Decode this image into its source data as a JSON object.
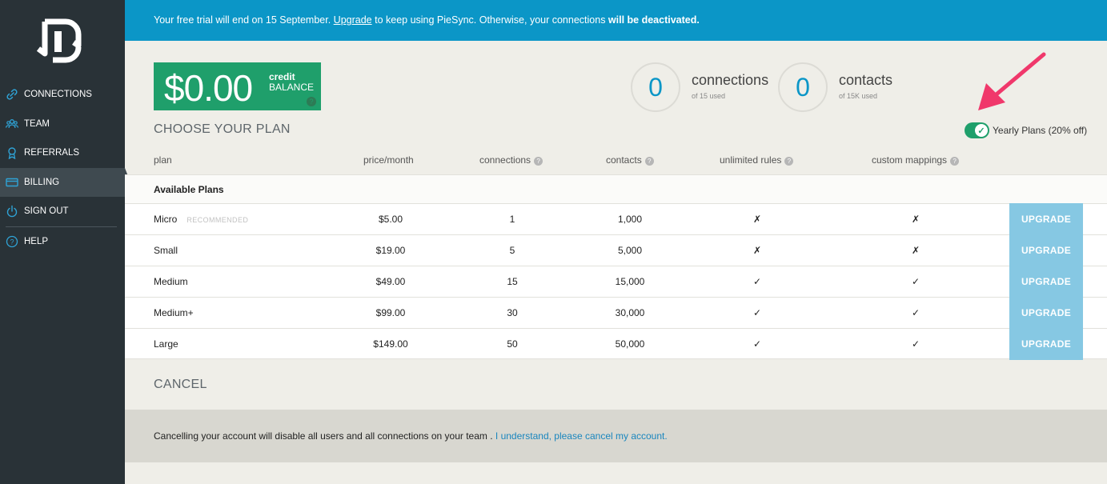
{
  "sidebar": {
    "items": [
      {
        "label": "CONNECTIONS",
        "icon": "link-icon"
      },
      {
        "label": "TEAM",
        "icon": "team-icon"
      },
      {
        "label": "REFERRALS",
        "icon": "award-icon"
      },
      {
        "label": "BILLING",
        "icon": "card-icon",
        "active": true
      },
      {
        "label": "SIGN OUT",
        "icon": "power-icon"
      },
      {
        "label": "HELP",
        "icon": "help-icon"
      }
    ]
  },
  "banner": {
    "before": "Your free trial will end on 15 September. ",
    "link": "Upgrade",
    "middle": " to keep using PieSync. Otherwise, your connections ",
    "bold": "will be deactivated."
  },
  "credit": {
    "amount": "$0.00",
    "label_top": "credit",
    "label_bottom": "BALANCE",
    "help": "?"
  },
  "stats": {
    "connections": {
      "count": "0",
      "label": "connections",
      "sub": "of 15 used"
    },
    "contacts": {
      "count": "0",
      "label": "contacts",
      "sub": "of 15K used"
    }
  },
  "plans": {
    "title": "CHOOSE YOUR PLAN",
    "yearly_toggle": {
      "label": "Yearly Plans (20% off)",
      "on": true,
      "check": "✓"
    },
    "headers": {
      "plan": "plan",
      "price": "price/month",
      "connections": "connections",
      "contacts": "contacts",
      "rules": "unlimited rules",
      "mappings": "custom mappings",
      "help": "?"
    },
    "group_label": "Available Plans",
    "rows": [
      {
        "name": "Micro",
        "badge": "RECOMMENDED",
        "price": "$5.00",
        "connections": "1",
        "contacts": "1,000",
        "rules": "✗",
        "mappings": "✗",
        "button": "UPGRADE"
      },
      {
        "name": "Small",
        "badge": "",
        "price": "$19.00",
        "connections": "5",
        "contacts": "5,000",
        "rules": "✗",
        "mappings": "✗",
        "button": "UPGRADE"
      },
      {
        "name": "Medium",
        "badge": "",
        "price": "$49.00",
        "connections": "15",
        "contacts": "15,000",
        "rules": "✓",
        "mappings": "✓",
        "button": "UPGRADE"
      },
      {
        "name": "Medium+",
        "badge": "",
        "price": "$99.00",
        "connections": "30",
        "contacts": "30,000",
        "rules": "✓",
        "mappings": "✓",
        "button": "UPGRADE"
      },
      {
        "name": "Large",
        "badge": "",
        "price": "$149.00",
        "connections": "50",
        "contacts": "50,000",
        "rules": "✓",
        "mappings": "✓",
        "button": "UPGRADE"
      }
    ]
  },
  "cancel": {
    "title": "CANCEL",
    "text": "Cancelling your account will disable all users and all connections on your team . ",
    "link": "I understand, please cancel my account."
  },
  "colors": {
    "sidebar": "#293237",
    "banner": "#0b96c7",
    "credit": "#1f9f6b",
    "upgrade": "#86c8e3",
    "arrow": "#f0386b"
  }
}
